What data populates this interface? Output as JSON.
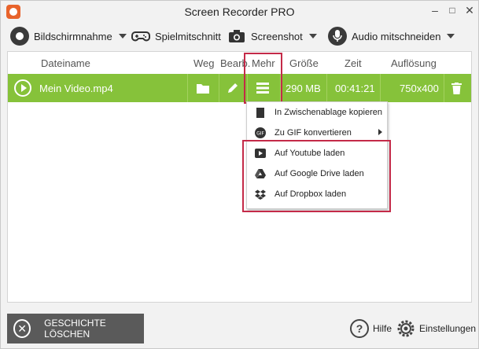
{
  "window": {
    "title": "Screen Recorder PRO",
    "minimize": "–",
    "maximize": "□",
    "close": "✕"
  },
  "toolbar": {
    "items": [
      {
        "label": "Bildschirmnahme",
        "icon": "record-icon"
      },
      {
        "label": "Spielmitschnitt",
        "icon": "gamepad-icon"
      },
      {
        "label": "Screenshot",
        "icon": "camera-icon"
      },
      {
        "label": "Audio mitschneiden",
        "icon": "microphone-icon"
      }
    ]
  },
  "table": {
    "headers": {
      "name": "Dateiname",
      "path": "Weg",
      "edit": "Bearb.",
      "more": "Mehr",
      "size": "Größe",
      "time": "Zeit",
      "resolution": "Auflösung"
    },
    "rows": [
      {
        "name": "Mein Video.mp4",
        "size": "290 MB",
        "time": "00:41:21",
        "resolution": "750x400"
      }
    ]
  },
  "context_menu": {
    "items": [
      {
        "label": "In Zwischenablage kopieren",
        "icon": "clipboard-icon"
      },
      {
        "label": "Zu GIF konvertieren",
        "icon": "gif-icon",
        "submenu": true
      },
      {
        "label": "Auf Youtube laden",
        "icon": "youtube-icon"
      },
      {
        "label": "Auf Google Drive laden",
        "icon": "google-drive-icon"
      },
      {
        "label": "Auf Dropbox laden",
        "icon": "dropbox-icon"
      }
    ]
  },
  "footer": {
    "clear_label": "GESCHICHTE LÖSCHEN",
    "help_label": "Hilfe",
    "settings_label": "Einstellungen"
  },
  "colors": {
    "row_highlight": "#86c23a",
    "annotation_red": "#c42a48",
    "footer_button": "#5a5a5a",
    "brand": "#e8632b"
  }
}
